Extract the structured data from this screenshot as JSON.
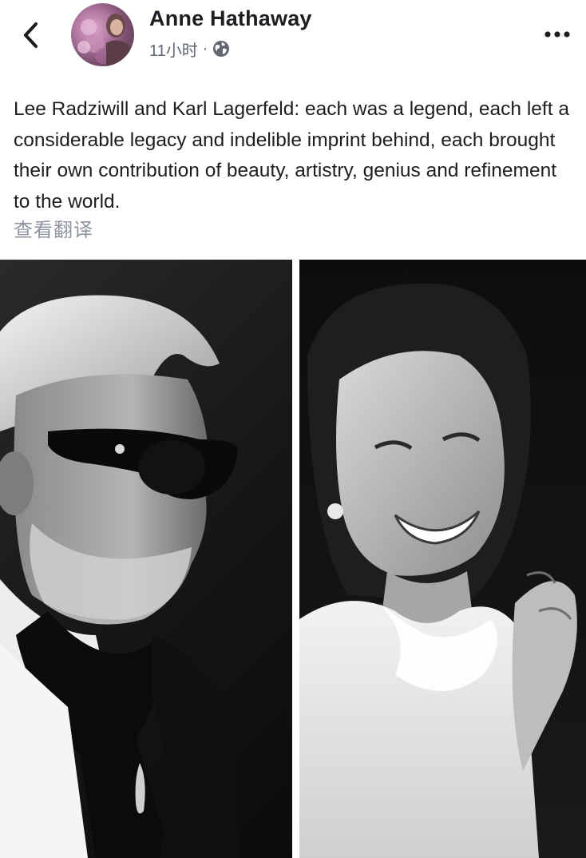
{
  "header": {
    "author_name": "Anne Hathaway",
    "timestamp": "11小时",
    "separator": "·",
    "back_icon": "chevron-left-icon",
    "privacy_icon": "globe-icon",
    "more_icon": "more-dots-icon"
  },
  "post": {
    "text": "Lee Radziwill and Karl Lagerfeld: each was a legend, each left a considerable legacy and indelible imprint behind, each brought their own contribution of beauty, artistry, genius and refinement to the world.",
    "translate_label": "查看翻译"
  },
  "colors": {
    "text_primary": "#1c1e21",
    "text_secondary": "#606770",
    "link_muted": "#8d949e",
    "background": "#ffffff"
  }
}
